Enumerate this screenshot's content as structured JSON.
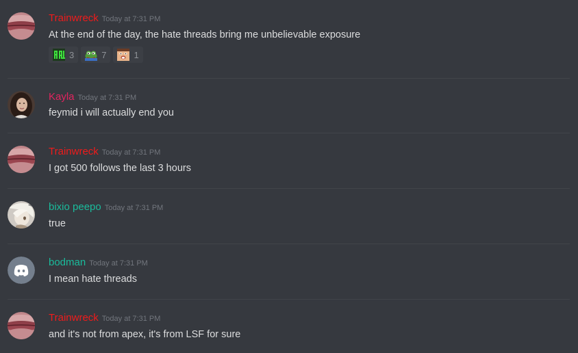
{
  "colors": {
    "background": "#36393f",
    "divider": "#42454a",
    "timestamp": "#72767d",
    "message_text": "#dcddde",
    "trainwreck": "#f01b1b",
    "kayla": "#e3245f",
    "bixio": "#1abc9c",
    "bodman": "#1abc9c"
  },
  "messages": [
    {
      "username": "Trainwreck",
      "timestamp": "Today at 7:31 PM",
      "text": "At the end of the day, the hate threads bring me unbelievable exposure",
      "avatar": "lips-avatar",
      "reactions": [
        {
          "emoji": "green-text-emoji",
          "count": "3"
        },
        {
          "emoji": "pepe-frog-emoji",
          "count": "7"
        },
        {
          "emoji": "face-emoji",
          "count": "1"
        }
      ]
    },
    {
      "username": "Kayla",
      "timestamp": "Today at 7:31 PM",
      "text": "feymid i will actually end you",
      "avatar": "photo-avatar"
    },
    {
      "username": "Trainwreck",
      "timestamp": "Today at 7:31 PM",
      "text": "I got 500 follows the last 3 hours",
      "avatar": "lips-avatar"
    },
    {
      "username": "bixio peepo",
      "timestamp": "Today at 7:31 PM",
      "text": "true",
      "avatar": "anime-avatar"
    },
    {
      "username": "bodman",
      "timestamp": "Today at 7:31 PM",
      "text": "I mean hate threads",
      "avatar": "discord-logo-avatar"
    },
    {
      "username": "Trainwreck",
      "timestamp": "Today at 7:31 PM",
      "text": "and it's not from apex, it's from LSF for sure",
      "avatar": "lips-avatar"
    }
  ]
}
